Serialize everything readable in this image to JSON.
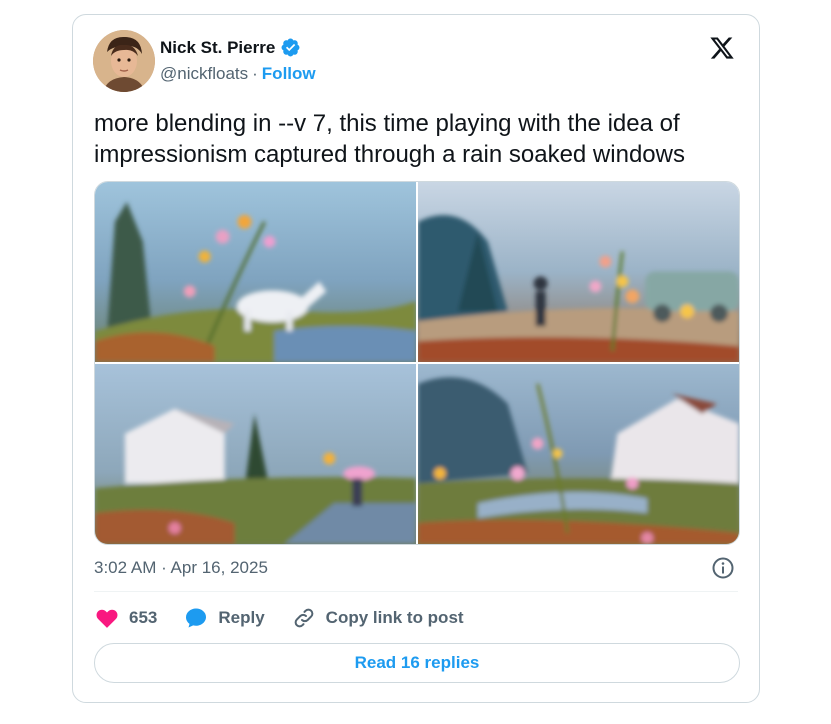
{
  "author": {
    "name": "Nick St. Pierre",
    "handle": "@nickfloats",
    "separator": "·",
    "follow_label": "Follow"
  },
  "tweet": {
    "text": "more blending in --v 7, this time playing with the idea of impressionism captured through a rain soaked windows",
    "timestamp": "3:02 AM · Apr 16, 2025"
  },
  "media": {
    "images": [
      {
        "subject": "rain-window-flowers-white-horse"
      },
      {
        "subject": "rain-window-figure-flowers-car"
      },
      {
        "subject": "rain-window-house-umbrella"
      },
      {
        "subject": "rain-window-house-flowers"
      }
    ]
  },
  "actions": {
    "like_count": "653",
    "reply_label": "Reply",
    "copy_label": "Copy link to post"
  },
  "read_replies_label": "Read 16 replies",
  "colors": {
    "accent": "#1d9bf0",
    "like": "#f91880",
    "text_secondary": "#536471",
    "border": "#cfd9de"
  },
  "icons": [
    "verified-badge-icon",
    "x-logo-icon",
    "info-icon",
    "heart-icon",
    "reply-bubble-icon",
    "link-icon"
  ]
}
